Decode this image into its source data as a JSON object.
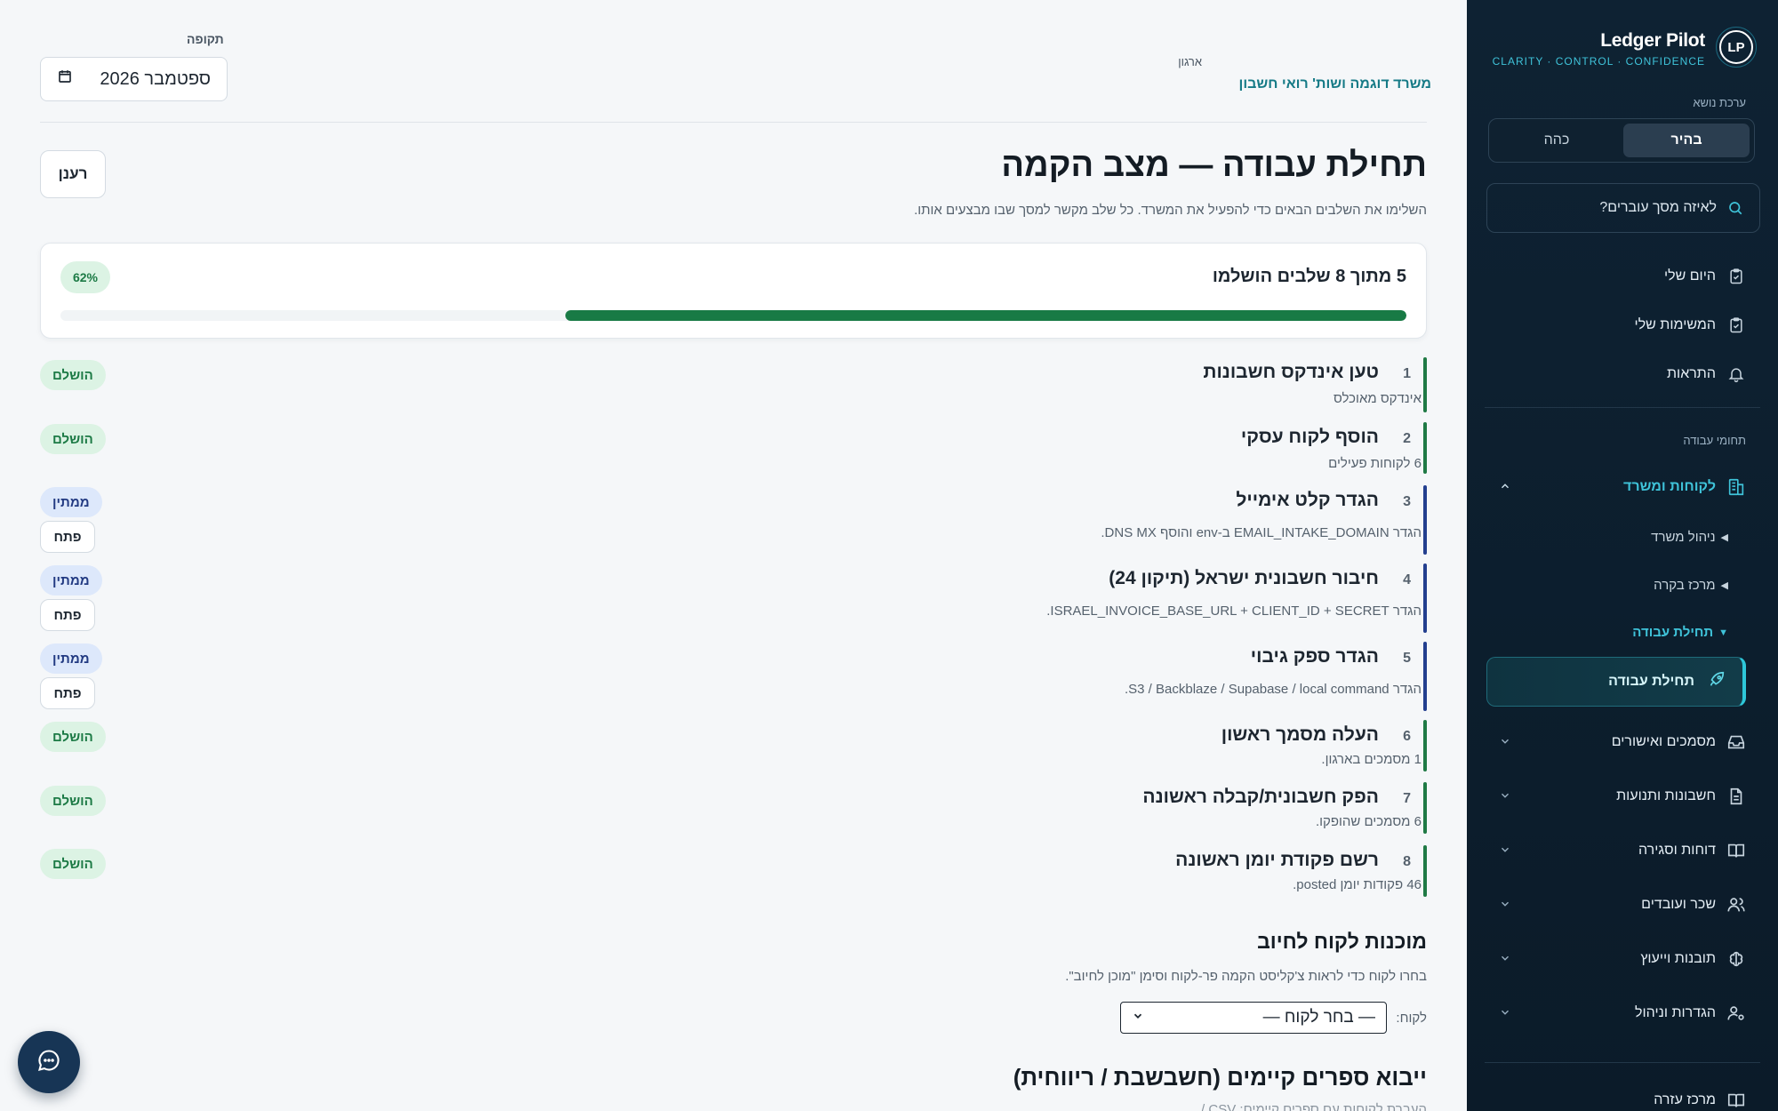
{
  "brand": {
    "name": "Ledger Pilot",
    "tagline": "CLARITY · CONTROL · CONFIDENCE",
    "logo": "LP"
  },
  "theme": {
    "label": "ערכת נושא",
    "light": "בהיר",
    "dark": "כהה"
  },
  "search": {
    "placeholder": "לאיזה מסך עוברים?"
  },
  "nav": {
    "my_day": "היום שלי",
    "my_tasks": "המשימות שלי",
    "alerts": "התראות",
    "section_label": "תחומי עבודה",
    "clients": "לקוחות ומשרד",
    "sub_office": "ניהול משרד",
    "sub_control": "מרכז בקרה",
    "sub_onboarding": "תחילת עבודה",
    "active_onboarding": "תחילת עבודה",
    "docs": "מסמכים ואישורים",
    "invoices": "חשבונות ותנועות",
    "reports": "דוחות וסגירה",
    "payroll": "שכר ועובדים",
    "insights": "תובנות וייעוץ",
    "settings": "הגדרות וניהול",
    "help": "מרכז עזרה"
  },
  "header": {
    "period_label": "תקופה",
    "period_value": "ספטמבר 2026",
    "org_label": "ארגון",
    "org_name": "משרד דוגמה ושות' רואי חשבון"
  },
  "page": {
    "title": "תחילת עבודה — מצב הקמה",
    "subtitle": "השלימו את השלבים הבאים כדי להפעיל את המשרד. כל שלב מקשר למסך שבו מבצעים אותו.",
    "refresh": "רענן"
  },
  "progress": {
    "title": "5 מתוך 8 שלבים הושלמו",
    "percent_label": "62%",
    "fraction": 0.625
  },
  "labels": {
    "done": "הושלם",
    "pending": "ממתין",
    "open": "פתח"
  },
  "steps": [
    {
      "num": "1",
      "title": "טען אינדקס חשבונות",
      "desc": "אינדקס מאוכלס",
      "status": "done"
    },
    {
      "num": "2",
      "title": "הוסף לקוח עסקי",
      "desc": "6 לקוחות פעילים",
      "status": "done"
    },
    {
      "num": "3",
      "title": "הגדר קלט אימייל",
      "desc": "הגדר EMAIL_INTAKE_DOMAIN ב-env והוסף DNS MX.",
      "status": "pending"
    },
    {
      "num": "4",
      "title": "חיבור חשבונית ישראל (תיקון 24)",
      "desc": "הגדר ISRAEL_INVOICE_BASE_URL + CLIENT_ID + SECRET.",
      "status": "pending"
    },
    {
      "num": "5",
      "title": "הגדר ספק גיבוי",
      "desc": "הגדר S3 / Backblaze / Supabase / local command.",
      "status": "pending"
    },
    {
      "num": "6",
      "title": "העלה מסמך ראשון",
      "desc": "1 מסמכים בארגון.",
      "status": "done"
    },
    {
      "num": "7",
      "title": "הפק חשבונית/קבלה ראשונה",
      "desc": "6 מסמכים שהופקו.",
      "status": "done"
    },
    {
      "num": "8",
      "title": "רשם פקודת יומן ראשונה",
      "desc": "46 פקודות יומן posted.",
      "status": "done"
    }
  ],
  "readiness": {
    "title": "מוכנות לקוח לחיוב",
    "subtitle": "בחרו לקוח כדי לראות צ'קליסט הקמה פר-לקוח וסימן \"מוכן לחיוב\".",
    "client_label": "לקוח:",
    "client_select": "— בחר לקוח —"
  },
  "import": {
    "title": "ייבוא ספרים קיימים (חשבשבת / ריווחית)",
    "subtitle": "העברת לקוחות עם ספרים קיימים: CSV / ..."
  }
}
